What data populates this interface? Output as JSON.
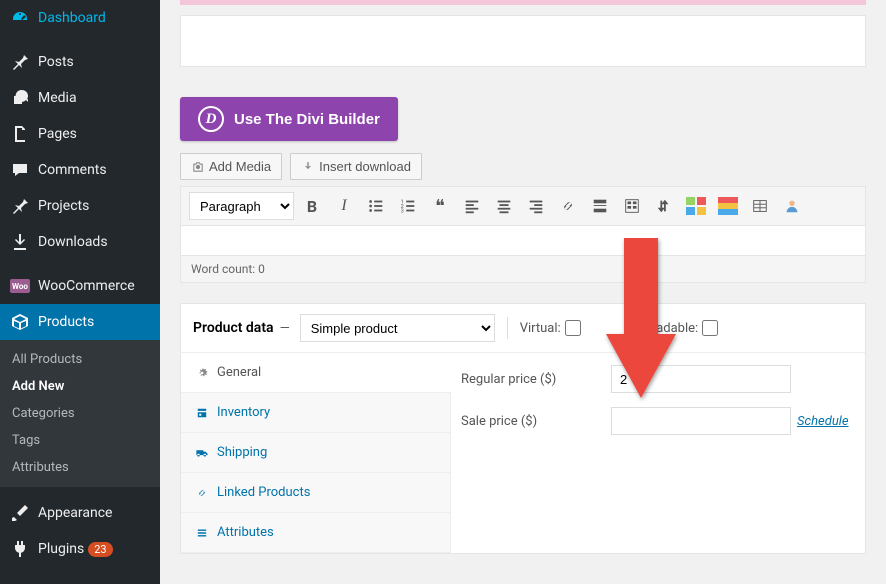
{
  "sidebar": {
    "items": [
      {
        "id": "dashboard",
        "label": "Dashboard"
      },
      {
        "id": "posts",
        "label": "Posts"
      },
      {
        "id": "media",
        "label": "Media"
      },
      {
        "id": "pages",
        "label": "Pages"
      },
      {
        "id": "comments",
        "label": "Comments"
      },
      {
        "id": "projects",
        "label": "Projects"
      },
      {
        "id": "downloads",
        "label": "Downloads"
      },
      {
        "id": "woocommerce",
        "label": "WooCommerce"
      },
      {
        "id": "products",
        "label": "Products"
      },
      {
        "id": "appearance",
        "label": "Appearance"
      },
      {
        "id": "plugins",
        "label": "Plugins",
        "badge": "23"
      }
    ],
    "submenu": [
      "All Products",
      "Add New",
      "Categories",
      "Tags",
      "Attributes"
    ]
  },
  "divi": {
    "label": "Use The Divi Builder"
  },
  "media_buttons": {
    "add_media": "Add Media",
    "insert_download": "Insert download"
  },
  "editor": {
    "format": "Paragraph",
    "word_count": "Word count: 0"
  },
  "product_data": {
    "title": "Product data",
    "dash": "—",
    "type": "Simple product",
    "virtual_label": "Virtual:",
    "downloadable_label": "Downloadable:",
    "downloadable_label_partial": "wnloadable:",
    "tabs": [
      "General",
      "Inventory",
      "Shipping",
      "Linked Products",
      "Attributes"
    ],
    "fields": {
      "regular_label": "Regular price ($)",
      "regular_value": "2",
      "sale_label": "Sale price ($)",
      "sale_value": "",
      "schedule": "Schedule"
    }
  }
}
